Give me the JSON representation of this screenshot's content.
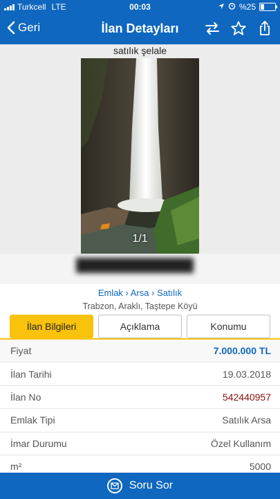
{
  "status_bar": {
    "carrier": "Turkcell",
    "network": "LTE",
    "time": "00:03",
    "battery": "%25",
    "battery_level": 0.25
  },
  "nav": {
    "back_label": "Geri",
    "title": "İlan Detayları"
  },
  "listing": {
    "photo_title": "satılık şelale",
    "photo_counter": "1/1",
    "breadcrumb": "Emlak › Arsa › Satılık",
    "location": "Trabzon, Araklı, Taştepe Köyü"
  },
  "tabs": [
    {
      "label": "İlan Bilgileri",
      "active": true
    },
    {
      "label": "Açıklama",
      "active": false
    },
    {
      "label": "Konumu",
      "active": false
    }
  ],
  "details": [
    {
      "label": "Fiyat",
      "value": "7.000.000 TL"
    },
    {
      "label": "İlan Tarihi",
      "value": "19.03.2018"
    },
    {
      "label": "İlan No",
      "value": "542440957"
    },
    {
      "label": "Emlak Tipi",
      "value": "Satılık Arsa"
    },
    {
      "label": "İmar Durumu",
      "value": "Özel Kullanım"
    },
    {
      "label": "m²",
      "value": "5000"
    }
  ],
  "bottom_bar": {
    "label": "Soru Sor"
  },
  "colors": {
    "brand_blue": "#0f67bf",
    "accent_yellow": "#f9c20c",
    "price_blue": "#0f67bf",
    "ad_no_red": "#8a1010"
  }
}
